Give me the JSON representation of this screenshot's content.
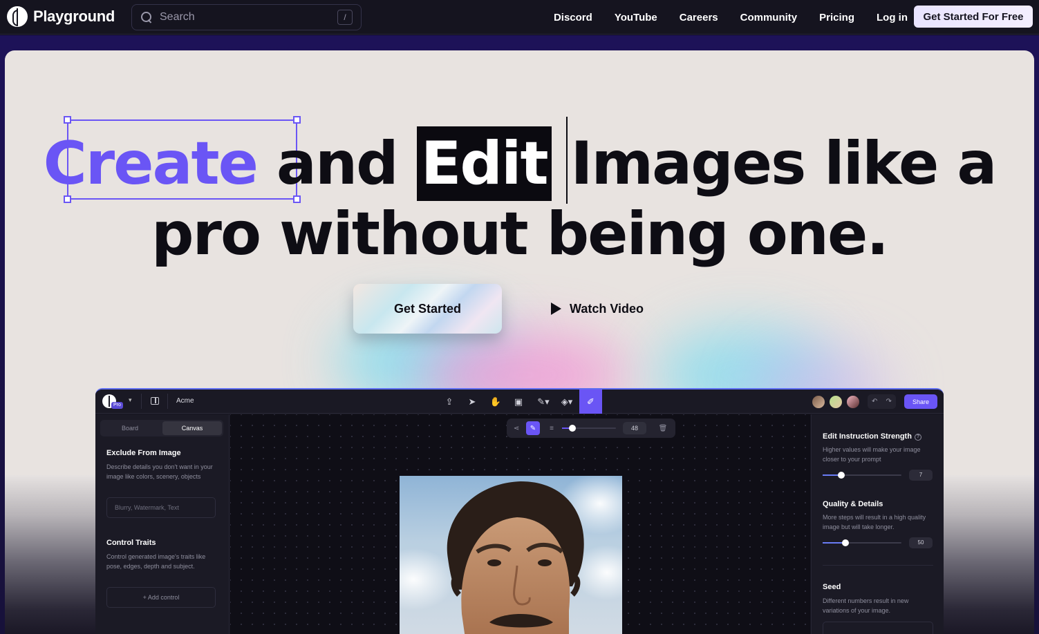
{
  "nav": {
    "brand": "Playground",
    "search_placeholder": "Search",
    "search_shortcut": "/",
    "links": [
      "Discord",
      "YouTube",
      "Careers",
      "Community",
      "Pricing",
      "Log in"
    ],
    "cta": "Get Started For Free"
  },
  "hero": {
    "headline_word_create": "Create",
    "headline_and": "and",
    "headline_word_edit": "Edit",
    "headline_rest_line1": "Images like a",
    "headline_line2": "pro without being one.",
    "primary_button": "Get Started",
    "secondary_button": "Watch Video",
    "accent_color": "#6a55f5"
  },
  "app": {
    "project_name": "Acme",
    "plan_badge": "Pro",
    "share_label": "Share",
    "tabs": [
      "Board",
      "Canvas"
    ],
    "active_tab": "Canvas",
    "brush_size": "48",
    "left_panel": {
      "exclude_title": "Exclude From Image",
      "exclude_desc": "Describe details you don't want in your image like colors, scenery, objects",
      "exclude_placeholder": "Blurry, Watermark, Text",
      "control_title": "Control Traits",
      "control_desc": "Control generated image's traits like pose, edges, depth and subject.",
      "add_control": "+ Add control"
    },
    "right_panel": {
      "edit_strength_title": "Edit Instruction Strength",
      "edit_strength_desc": "Higher values will make your image closer to your prompt",
      "edit_strength_value": "7",
      "quality_title": "Quality & Details",
      "quality_desc": "More steps will result in a high quality image but will take longer.",
      "quality_value": "50",
      "seed_title": "Seed",
      "seed_desc": "Different numbers result in new variations of your image."
    },
    "tool_icons": [
      "upload-icon",
      "pointer-icon",
      "hand-icon",
      "image-icon",
      "pen-icon",
      "fill-icon",
      "brush-icon"
    ]
  }
}
